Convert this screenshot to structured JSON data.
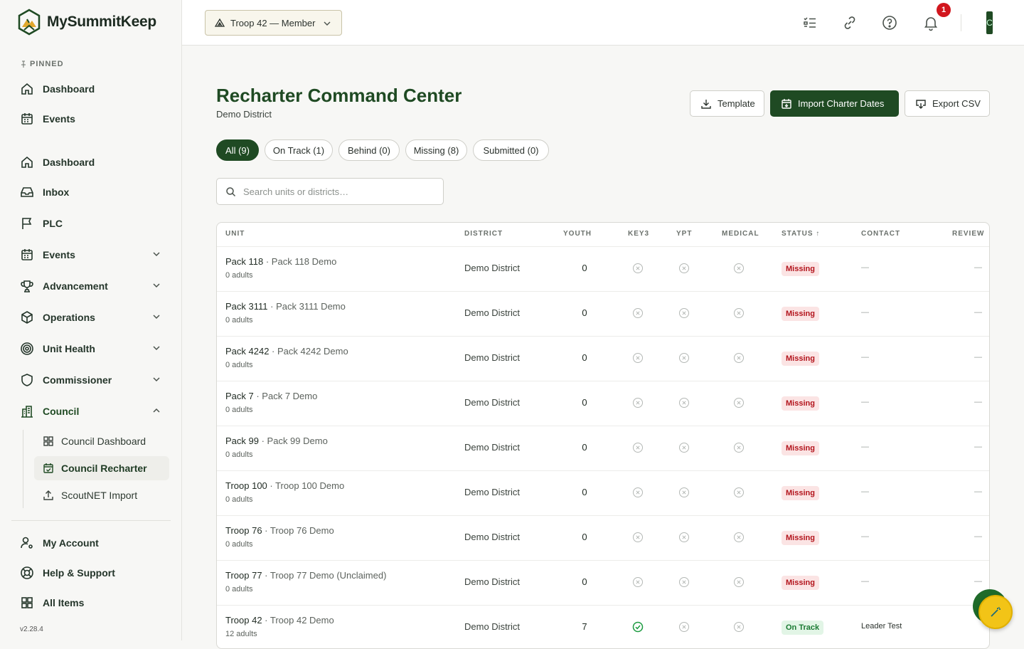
{
  "app": {
    "name": "MySummitKeep",
    "version": "v2.28.4"
  },
  "sidebar": {
    "pinned_label": "PINNED",
    "pinned": [
      {
        "label": "Dashboard",
        "icon": "home-icon"
      },
      {
        "label": "Events",
        "icon": "calendar-icon"
      }
    ],
    "items": [
      {
        "label": "Dashboard",
        "icon": "home-icon"
      },
      {
        "label": "Inbox",
        "icon": "inbox-icon"
      },
      {
        "label": "PLC",
        "icon": "flag-icon"
      },
      {
        "label": "Events",
        "icon": "calendar-icon",
        "expandable": true
      },
      {
        "label": "Advancement",
        "icon": "trophy-icon",
        "expandable": true
      },
      {
        "label": "Operations",
        "icon": "box-icon",
        "expandable": true
      },
      {
        "label": "Unit Health",
        "icon": "target-icon",
        "expandable": true
      },
      {
        "label": "Commissioner",
        "icon": "shield-icon",
        "expandable": true
      },
      {
        "label": "Council",
        "icon": "building-icon",
        "expandable": true,
        "expanded": true
      }
    ],
    "council_sub": [
      {
        "label": "Council Dashboard",
        "icon": "grid-icon"
      },
      {
        "label": "Council Recharter",
        "icon": "calendar-check-icon",
        "active": true
      },
      {
        "label": "ScoutNET Import",
        "icon": "upload-icon"
      }
    ],
    "footer": [
      {
        "label": "My Account",
        "icon": "user-settings-icon"
      },
      {
        "label": "Help & Support",
        "icon": "lifebuoy-icon"
      },
      {
        "label": "All Items",
        "icon": "grid-icon"
      }
    ]
  },
  "topbar": {
    "troop_select": "Troop 42 — Member",
    "notification_count": "1",
    "avatar_initial": "C"
  },
  "page": {
    "title": "Recharter Command Center",
    "subtitle": "Demo District",
    "buttons": {
      "template": "Template",
      "import": "Import Charter Dates",
      "export": "Export CSV"
    },
    "filters": [
      {
        "label": "All (9)",
        "active": true
      },
      {
        "label": "On Track (1)"
      },
      {
        "label": "Behind (0)"
      },
      {
        "label": "Missing (8)"
      },
      {
        "label": "Submitted (0)"
      }
    ],
    "search_placeholder": "Search units or districts…"
  },
  "table": {
    "headers": {
      "unit": "UNIT",
      "district": "DISTRICT",
      "youth": "YOUTH",
      "key3": "KEY3",
      "ypt": "YPT",
      "medical": "MEDICAL",
      "status": "STATUS ↑",
      "contact": "CONTACT",
      "review": "REVIEW"
    },
    "rows": [
      {
        "unit": "Pack 118",
        "name": " · Pack 118 Demo",
        "adults": "0 adults",
        "district": "Demo District",
        "youth": "0",
        "key3": false,
        "ypt": false,
        "medical": false,
        "status": "Missing",
        "contact": "—",
        "review": "—"
      },
      {
        "unit": "Pack 3111",
        "name": " · Pack 3111 Demo",
        "adults": "0 adults",
        "district": "Demo District",
        "youth": "0",
        "key3": false,
        "ypt": false,
        "medical": false,
        "status": "Missing",
        "contact": "—",
        "review": "—"
      },
      {
        "unit": "Pack 4242",
        "name": " · Pack 4242 Demo",
        "adults": "0 adults",
        "district": "Demo District",
        "youth": "0",
        "key3": false,
        "ypt": false,
        "medical": false,
        "status": "Missing",
        "contact": "—",
        "review": "—"
      },
      {
        "unit": "Pack 7",
        "name": " · Pack 7 Demo",
        "adults": "0 adults",
        "district": "Demo District",
        "youth": "0",
        "key3": false,
        "ypt": false,
        "medical": false,
        "status": "Missing",
        "contact": "—",
        "review": "—"
      },
      {
        "unit": "Pack 99",
        "name": " · Pack 99 Demo",
        "adults": "0 adults",
        "district": "Demo District",
        "youth": "0",
        "key3": false,
        "ypt": false,
        "medical": false,
        "status": "Missing",
        "contact": "—",
        "review": "—"
      },
      {
        "unit": "Troop 100",
        "name": " · Troop 100 Demo",
        "adults": "0 adults",
        "district": "Demo District",
        "youth": "0",
        "key3": false,
        "ypt": false,
        "medical": false,
        "status": "Missing",
        "contact": "—",
        "review": "—"
      },
      {
        "unit": "Troop 76",
        "name": " · Troop 76 Demo",
        "adults": "0 adults",
        "district": "Demo District",
        "youth": "0",
        "key3": false,
        "ypt": false,
        "medical": false,
        "status": "Missing",
        "contact": "—",
        "review": "—"
      },
      {
        "unit": "Troop 77",
        "name": " · Troop 77 Demo (Unclaimed)",
        "adults": "0 adults",
        "district": "Demo District",
        "youth": "0",
        "key3": false,
        "ypt": false,
        "medical": false,
        "status": "Missing",
        "contact": "—",
        "review": "—"
      },
      {
        "unit": "Troop 42",
        "name": " · Troop 42 Demo",
        "adults": "12 adults",
        "district": "Demo District",
        "youth": "7",
        "key3": true,
        "ypt": false,
        "medical": false,
        "status": "On Track",
        "contact": "Leader Test",
        "review": ""
      }
    ]
  },
  "colors": {
    "brand": "#1f4a23",
    "missing": "#b3141c",
    "ontrack": "#1b7a33",
    "fab": "#f2c417"
  }
}
